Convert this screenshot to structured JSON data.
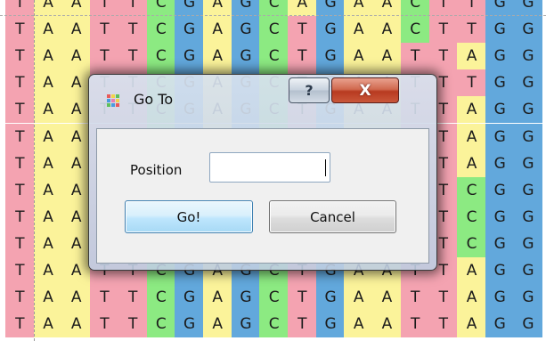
{
  "alignment": {
    "colors": {
      "T": "#f4a3b1",
      "A": "#fbf39a",
      "C": "#8cea82",
      "G": "#62a8dc"
    },
    "rows": [
      "TAATTCGAGCAGAACTTGG",
      "TAATTCGAGCTGAACTTGG",
      "TAATTCGAGCTGAATTAGG",
      "TAATTCGAGCTGAATTTGG",
      "TAATTCGAGCTGAATTAGG",
      "TAATTCGAGCTGAATTAGG",
      "TAATTCGAGCTGAATTAGG",
      "TAATTCGAGCTGAATTCGG",
      "TAATTCGAGCTGAATTCGG",
      "TAATTCGAGCCGAACTCGG",
      "TAATTCGAGCTGAATTAGG",
      "TAATTCGAGCTGAATTAGG",
      "TAATTCGAGCTGAATTAGG"
    ]
  },
  "dialog": {
    "title": "Go To",
    "help_label": "?",
    "close_label": "X",
    "position_label": "Position",
    "position_value": "",
    "go_label": "Go!",
    "cancel_label": "Cancel",
    "icons": {
      "app": "colored-grid-icon",
      "help": "help-icon",
      "close": "close-icon"
    }
  }
}
